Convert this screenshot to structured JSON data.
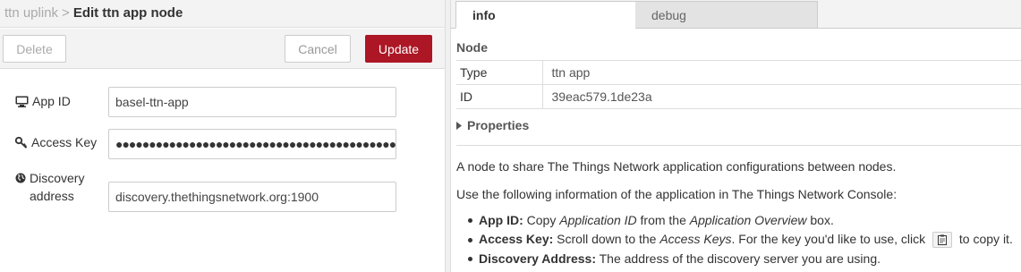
{
  "left": {
    "breadcrumb": {
      "parent": "ttn uplink",
      "separator": ">",
      "current": "Edit ttn app node"
    },
    "buttons": {
      "delete": "Delete",
      "cancel": "Cancel",
      "update": "Update"
    },
    "fields": [
      {
        "label": "App ID",
        "icon": "monitor-icon",
        "value": "basel-ttn-app"
      },
      {
        "label": "Access Key",
        "icon": "key-icon",
        "value": "●●●●●●●●●●●●●●●●●●●●●●●●●●●●●●●●●●●●●●●●●●"
      },
      {
        "label": "Discovery address",
        "icon": "globe-icon",
        "value": "discovery.thethingsnetwork.org:1900"
      }
    ]
  },
  "right": {
    "tabs": [
      {
        "label": "info",
        "active": true
      },
      {
        "label": "debug",
        "active": false
      }
    ],
    "node_heading": "Node",
    "node_table": [
      {
        "key": "Type",
        "value": "ttn app"
      },
      {
        "key": "ID",
        "value": "39eac579.1de23a"
      }
    ],
    "properties_label": "Properties",
    "description": [
      "A node to share The Things Network application configurations between nodes.",
      "Use the following information of the application in The Things Network Console:"
    ],
    "bullets": {
      "app_id": {
        "title": "App ID:",
        "t1": " Copy ",
        "em1": "Application ID",
        "t2": " from the ",
        "em2": "Application Overview",
        "t3": " box."
      },
      "access_key": {
        "title": "Access Key:",
        "t1": " Scroll down to the ",
        "em1": "Access Keys",
        "t2": ". For the key you'd like to use, click ",
        "t3": " to copy it."
      },
      "discovery": {
        "title": "Discovery Address:",
        "t1": " The address of the discovery server you are using."
      }
    }
  },
  "colors": {
    "accent": "#ad1625",
    "header_bg": "#f3f3f3",
    "border": "#dddddd"
  }
}
